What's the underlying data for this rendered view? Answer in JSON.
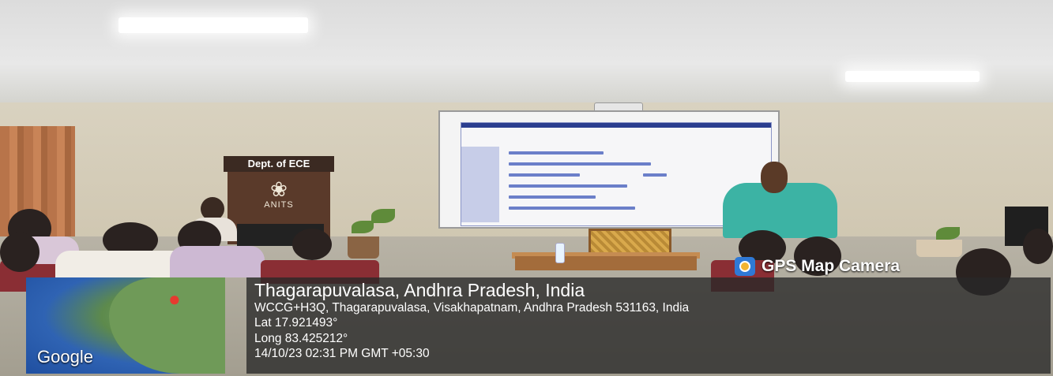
{
  "scene": {
    "podium_sign": "Dept. of ECE",
    "podium_emblem_text": "ANITS"
  },
  "overlay": {
    "app_name": "GPS Map Camera",
    "app_icon": "gps-map-camera-icon",
    "location_title": "Thagarapuvalasa, Andhra Pradesh, India",
    "address": "WCCG+H3Q, Thagarapuvalasa, Visakhapatnam, Andhra Pradesh 531163, India",
    "latitude": "Lat 17.921493°",
    "longitude": "Long 83.425212°",
    "timestamp": "14/10/23 02:31 PM GMT +05:30",
    "map_attribution": "Google"
  },
  "colors": {
    "overlay_bg": "#282828",
    "speaker_shirt": "#3cb3a4",
    "chair_red": "#8a2e34"
  }
}
